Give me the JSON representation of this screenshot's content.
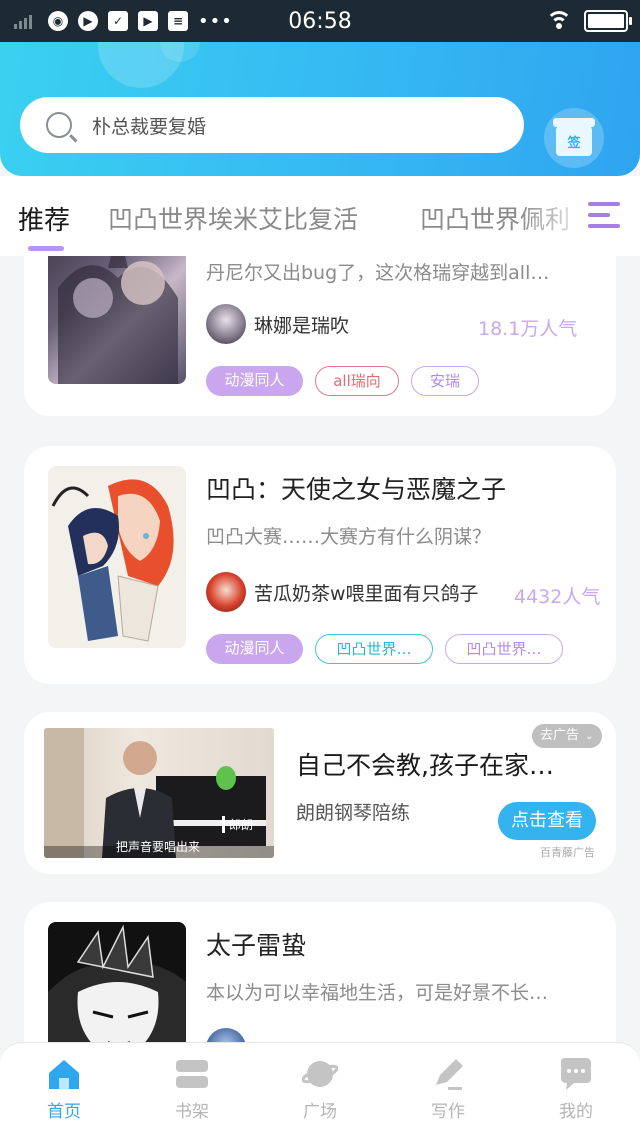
{
  "status_bar": {
    "time": "06:58",
    "dots": "•••"
  },
  "search": {
    "placeholder": "朴总裁要复婚"
  },
  "gift": {
    "label": "签"
  },
  "tabs": [
    {
      "label": "推荐"
    },
    {
      "label": "凹凸世界埃米艾比复活"
    },
    {
      "label": "凹凸世界佩利"
    }
  ],
  "feed": {
    "cards": [
      {
        "desc": "丹尼尔又出bug了，这次格瑞穿越到all…",
        "author": "琳娜是瑞吹",
        "popularity": "18.1万人气",
        "tags": [
          "动漫同人",
          "all瑞向",
          "安瑞"
        ]
      },
      {
        "title": "凹凸：天使之女与恶魔之子",
        "desc": "凹凸大赛……大赛方有什么阴谋？",
        "author": "苦瓜奶茶w喂里面有只鸽子",
        "popularity": "4432人气",
        "tags": [
          "动漫同人",
          "凹凸世界…",
          "凹凸世界…"
        ]
      },
      {
        "title": "太子雷蛰",
        "desc": "本以为可以幸福地生活，可是好景不长…"
      }
    ],
    "ad": {
      "close_label": "去广告",
      "title": "自己不会教,孩子在家…",
      "desc": "朗朗钢琴陪练",
      "button": "点击查看",
      "source": "百青藤广告",
      "image_caption": "把声音要唱出来",
      "image_name": "郎朗"
    }
  },
  "bottom_nav": [
    {
      "label": "首页",
      "icon": "home-icon",
      "active": true
    },
    {
      "label": "书架",
      "icon": "bookshelf-icon",
      "active": false
    },
    {
      "label": "广场",
      "icon": "planet-icon",
      "active": false
    },
    {
      "label": "写作",
      "icon": "pen-icon",
      "active": false
    },
    {
      "label": "我的",
      "icon": "chat-bubble-icon",
      "active": false
    }
  ],
  "colors": {
    "accent": "#2fa7ef",
    "tab_indicator": "#b496f0",
    "popularity": "#c9a8ef"
  }
}
